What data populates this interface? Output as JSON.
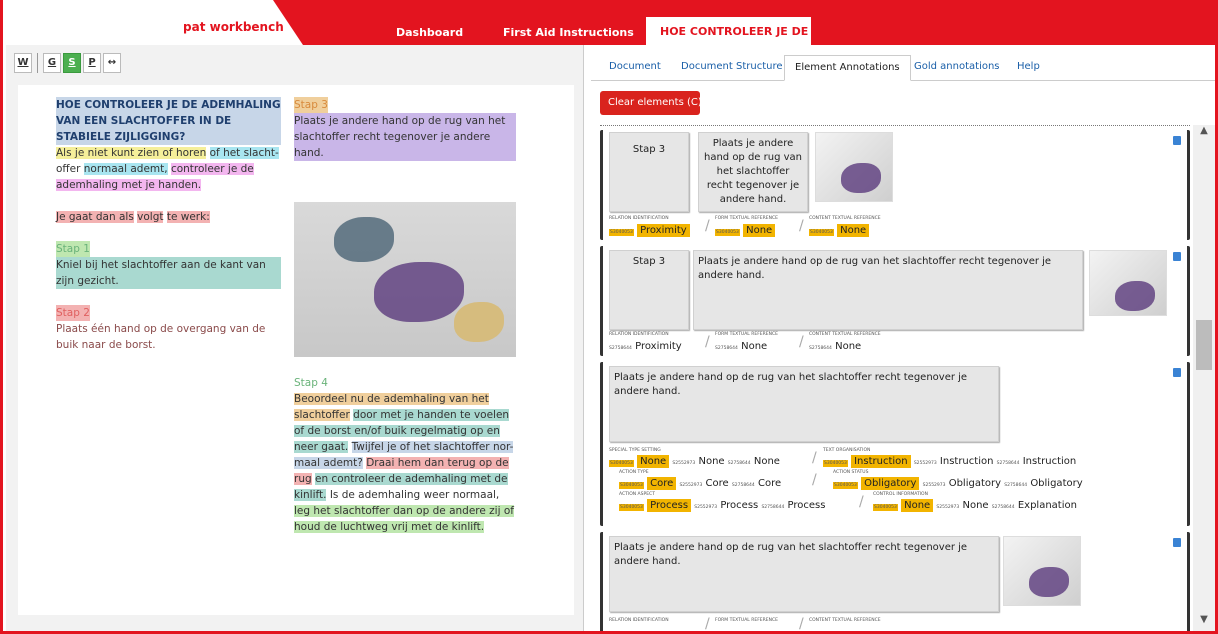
{
  "header": {
    "brand": "pat workbench",
    "nav": [
      "Dashboard",
      "First Aid Instructions"
    ],
    "active_tab": "HOE CONTROLEER JE DE AD"
  },
  "left": {
    "tools": [
      "W",
      "G",
      "S",
      "P",
      "↔"
    ],
    "active_tool": "S",
    "doc": {
      "title": "HOE CONTROLEER JE DE ADEMHALING VAN EEN SLACHTOFFER IN DE STABIELE ZIJLIGGING?",
      "intro_a": "Als je niet kunt zien of horen",
      "intro_b": "of het slacht-",
      "intro_c": "offer",
      "intro_d": "normaal ademt,",
      "intro_e": "controleer je de ademhaling met je handen.",
      "work_a": "Je gaat dan als",
      "work_b": "volgt",
      "work_c": "te werk:",
      "step1": "Stap 1",
      "step1_text": "Kniel bij het slachtoffer aan de kant van zijn gezicht.",
      "step2": "Stap 2",
      "step2_text": "Plaats één hand op de overgang van de buik naar de borst.",
      "step3": "Stap 3",
      "step3_text": "Plaats je andere hand op de rug van het slachtoffer recht tegenover je andere hand.",
      "step4": "Stap 4",
      "step4_text_a": "Beoordeel nu de ademhaling van het slachtoffer",
      "step4_text_b": "door met je handen te voelen of de borst en/of buik regelmatig op en neer gaat.",
      "step4_text_c": "Twijfel je of het slachtoffer nor-maal ademt?",
      "step4_text_d": "Draai hem dan terug op de rug",
      "step4_text_e": "en controleer de ademhaling met de kinlift.",
      "step4_text_f": "Is de ademhaling weer normaal,",
      "step4_text_g": "leg het slachtoffer dan op de andere zij of houd de luchtweg vrij met de kinlift."
    }
  },
  "right": {
    "tabs": [
      "Document",
      "Document Structure",
      "Element Annotations",
      "Gold annotations",
      "Help"
    ],
    "active_tab": "Element Annotations",
    "clear_button": "Clear elements (C)",
    "cards": [
      {
        "step_label": "Stap 3",
        "text": "Plaats je andere hand op de rug van het slachtoffer recht tegenover je andere hand.",
        "labels": [
          "RELATION IDENTIFICATION",
          "FORM TEXTUAL REFERENCE",
          "CONTENT TEXTUAL REFERENCE"
        ],
        "ids": [
          "S3040053",
          "S3040053",
          "S3040053"
        ],
        "values": [
          "Proximity",
          "None",
          "None"
        ]
      },
      {
        "step_label": "Stap 3",
        "text": "Plaats je andere hand op de rug van het slachtoffer recht tegenover je andere hand.",
        "labels": [
          "RELATION IDENTIFICATION",
          "FORM TEXTUAL REFERENCE",
          "CONTENT TEXTUAL REFERENCE"
        ],
        "ids": [
          "S2758644",
          "S2758644",
          "S2758644"
        ],
        "values": [
          "Proximity",
          "None",
          "None"
        ]
      },
      {
        "text": "Plaats je andere hand op de rug van het slachtoffer recht tegenover je andere hand.",
        "row1": {
          "label_a": "SPECIAL TYPE SETTING",
          "label_b": "TEXT ORGANISATION",
          "ids_a": [
            "S3040053",
            "S2552973",
            "S2758644"
          ],
          "vals_a": [
            "None",
            "None",
            "None"
          ],
          "ids_b": [
            "S3040053",
            "S2552973",
            "S2758644"
          ],
          "vals_b": [
            "Instruction",
            "Instruction",
            "Instruction"
          ]
        },
        "row2": {
          "label_a": "ACTION TYPE",
          "label_b": "ACTION STATUS",
          "ids_a": [
            "S3040053",
            "S2552973",
            "S2758644"
          ],
          "vals_a": [
            "Core",
            "Core",
            "Core"
          ],
          "ids_b": [
            "S3040053",
            "S2552973",
            "S2758644"
          ],
          "vals_b": [
            "Obligatory",
            "Obligatory",
            "Obligatory"
          ]
        },
        "row3": {
          "label_a": "ACTION ASPECT",
          "label_b": "CONTROL INFORMATION",
          "ids_a": [
            "S3040053",
            "S2552973",
            "S2758644"
          ],
          "vals_a": [
            "Process",
            "Process",
            "Process"
          ],
          "ids_b": [
            "S3040053",
            "S2552973",
            "S2758644"
          ],
          "vals_b": [
            "None",
            "None",
            "Explanation"
          ]
        }
      },
      {
        "text": "Plaats je andere hand op de rug van het slachtoffer recht tegenover je andere hand.",
        "labels": [
          "RELATION IDENTIFICATION",
          "FORM TEXTUAL REFERENCE",
          "CONTENT TEXTUAL REFERENCE"
        ]
      }
    ]
  }
}
